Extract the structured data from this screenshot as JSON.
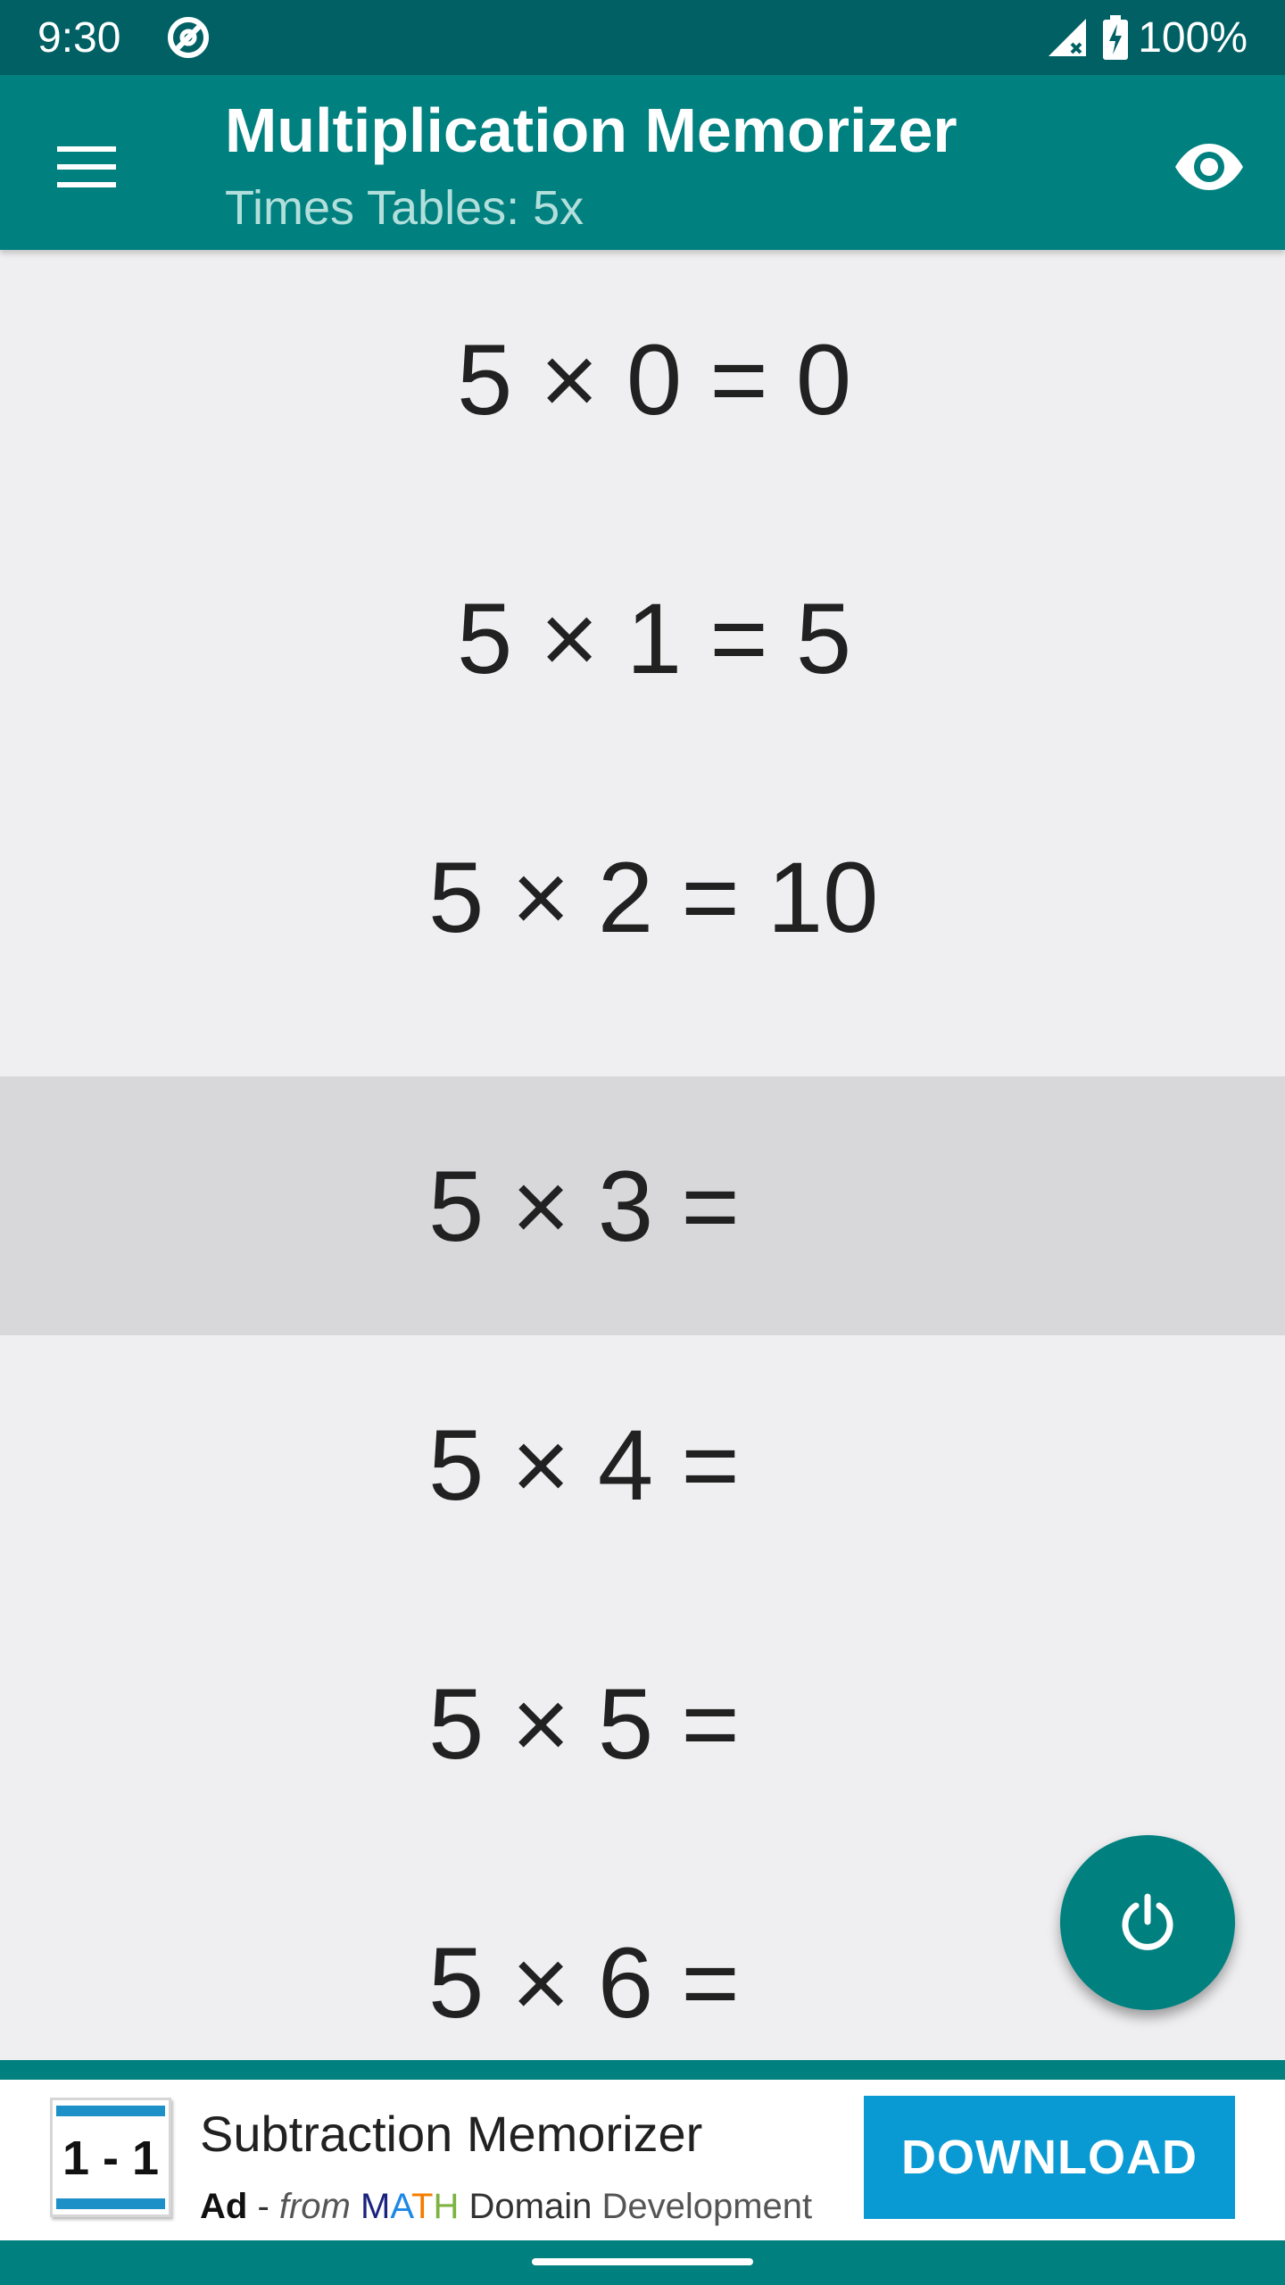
{
  "status_bar": {
    "time": "9:30",
    "battery": "100%",
    "icons": [
      "sync-icon",
      "signal-icon",
      "battery-charging-icon"
    ]
  },
  "app_bar": {
    "title": "Multiplication Memorizer",
    "subtitle": "Times Tables: 5x",
    "icons": [
      "menu-icon",
      "eye-icon"
    ]
  },
  "facts": [
    {
      "text": "5 × 0 = 0"
    },
    {
      "text": "5 × 1 = 5"
    },
    {
      "text": "5 × 2 = 10"
    },
    {
      "text": "5 × 3 =",
      "selected": true
    },
    {
      "text": "5 × 4 ="
    },
    {
      "text": "5 × 5 ="
    },
    {
      "text": "5 × 6 ="
    }
  ],
  "fab": {
    "icon": "power-icon"
  },
  "ad": {
    "thumb_text": "1 - 1",
    "title": "Subtraction Memorizer",
    "label": "Ad",
    "separator": " - ",
    "from": "from",
    "brand_letters": [
      "M",
      "A",
      "T",
      "H"
    ],
    "brand_rest": "Domain",
    "brand_tail": "Development",
    "cta": "DOWNLOAD"
  },
  "colors": {
    "status_bar": "#006064",
    "app_bar": "#00807f",
    "background": "#efeff1",
    "selected_row": "#d8d8da",
    "download_button": "#0a9ad3"
  }
}
